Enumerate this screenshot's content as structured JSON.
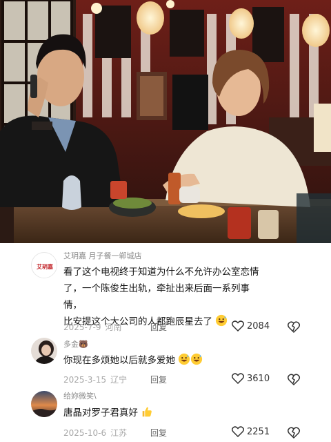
{
  "comments": [
    {
      "author": "艾玥嘉 月子餐一郸城店",
      "avatar_text": "艾玥嘉",
      "lines": [
        "看了这个电视终于知道为什么不允许办公室恋情",
        "了，一个陈俊生出轨，牵扯出来后面一系列事情，",
        "比安提这个大公司的人都跑辰星去了"
      ],
      "emojis": [
        "grinning-sweat-emoji"
      ],
      "date": "2025-7-9",
      "location": "河南",
      "reply_label": "回复",
      "likes": "2084"
    },
    {
      "author": "多金",
      "author_emoji": "🐻",
      "text": "你现在多烦她以后就多爱她",
      "emojis": [
        "grinning-sweat-emoji",
        "grinning-sweat-emoji"
      ],
      "date": "2025-3-15",
      "location": "辽宁",
      "reply_label": "回复",
      "likes": "3610"
    },
    {
      "author": "给妳微笑\\",
      "text": "唐晶对罗子君真好",
      "emojis": [
        "thumbs-up-emoji"
      ],
      "date": "2025-10-6",
      "location": "江苏",
      "reply_label": "回复",
      "likes": "2251"
    }
  ],
  "colors": {
    "meta_gray": "#a7a7a7",
    "author_gray": "#8a8a8a",
    "text_dark": "#151515",
    "scene_red": "#b02a22"
  }
}
